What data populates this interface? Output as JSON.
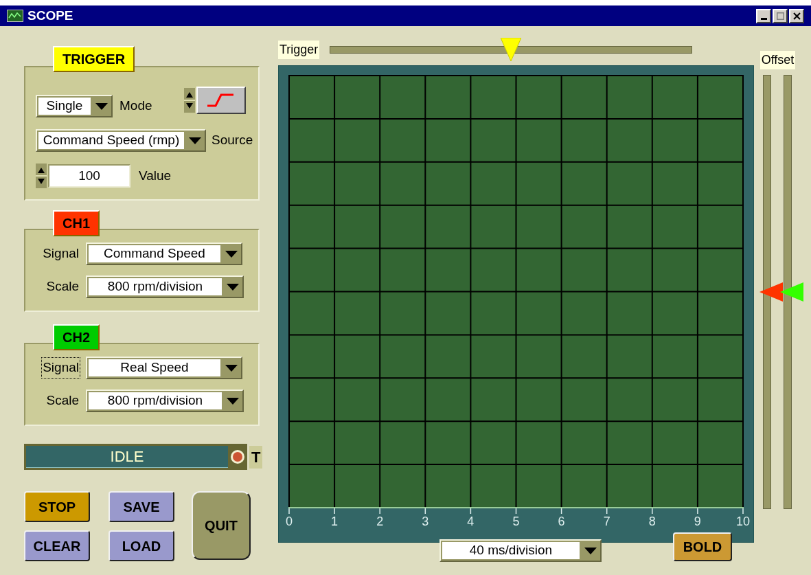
{
  "window": {
    "title": "SCOPE"
  },
  "trigger": {
    "label": "TRIGGER",
    "mode": {
      "label": "Mode",
      "value": "Single"
    },
    "source": {
      "label": "Source",
      "value": "Command Speed (rmp)"
    },
    "value": {
      "label": "Value",
      "value": "100"
    }
  },
  "channels": [
    {
      "label": "CH1",
      "color": "#ff3300",
      "signal": {
        "label": "Signal",
        "value": "Command Speed",
        "focused": false
      },
      "scale": {
        "label": "Scale",
        "value": "800 rpm/division"
      }
    },
    {
      "label": "CH2",
      "color": "#00cc00",
      "signal": {
        "label": "Signal",
        "value": "Real Speed",
        "focused": true
      },
      "scale": {
        "label": "Scale",
        "value": "800 rpm/division"
      }
    }
  ],
  "status": {
    "text": "IDLE",
    "indicator": "T"
  },
  "buttons": [
    {
      "label": "STOP",
      "kind": "small",
      "color": "#cc9900"
    },
    {
      "label": "SAVE",
      "kind": "small",
      "color": "#9999cc"
    },
    {
      "label": "QUIT",
      "kind": "tall",
      "color": "#999966"
    },
    {
      "label": "CLEAR",
      "kind": "small",
      "color": "#9999cc"
    },
    {
      "label": "LOAD",
      "kind": "small",
      "color": "#9999cc"
    }
  ],
  "trigger_slider": {
    "label": "Trigger",
    "level": 0.5
  },
  "scope": {
    "x_ticks": [
      "0",
      "1",
      "2",
      "3",
      "4",
      "5",
      "6",
      "7",
      "8",
      "9",
      "10"
    ],
    "timebase": "40 ms/division",
    "bold_button": "BOLD"
  },
  "offset": {
    "label": "Offset",
    "sliders": [
      {
        "level": 0.5,
        "color": "#ff3300"
      },
      {
        "level": 0.5,
        "color": "#33ff00"
      }
    ]
  }
}
